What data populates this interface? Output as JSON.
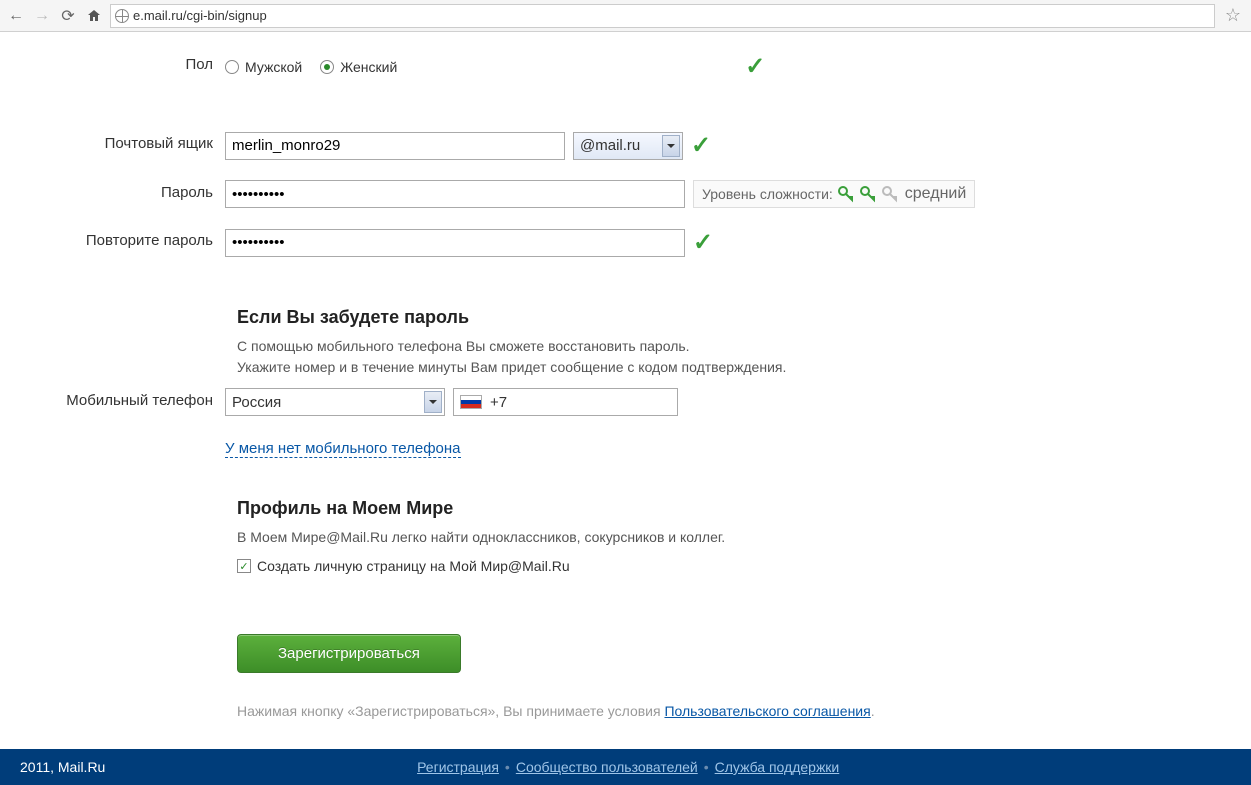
{
  "browser": {
    "url": "e.mail.ru/cgi-bin/signup"
  },
  "form": {
    "gender": {
      "label": "Пол",
      "male": "Мужской",
      "female": "Женский",
      "selected": "female"
    },
    "mailbox": {
      "label": "Почтовый ящик",
      "value": "merlin_monro29",
      "domain": "@mail.ru"
    },
    "password": {
      "label": "Пароль",
      "value": "••••••••••",
      "strength_label": "Уровень сложности:",
      "strength_text": "средний"
    },
    "password_repeat": {
      "label": "Повторите пароль",
      "value": "••••••••••"
    },
    "recovery": {
      "heading": "Если Вы забудете пароль",
      "desc1": "С помощью мобильного телефона Вы сможете восстановить пароль.",
      "desc2": "Укажите номер и в течение минуты Вам придет сообщение с кодом подтверждения."
    },
    "phone": {
      "label": "Мобильный телефон",
      "country": "Россия",
      "prefix": "+7",
      "no_phone_link": "У меня нет мобильного телефона"
    },
    "profile": {
      "heading": "Профиль на Моем Мире",
      "desc": "В Моем Мире@Mail.Ru легко найти одноклассников, сокурсников и коллег.",
      "checkbox_label": "Создать личную страницу на Мой Мир@Mail.Ru"
    },
    "submit": {
      "button": "Зарегистрироваться",
      "terms_prefix": "Нажимая кнопку «Зарегистрироваться», Вы принимаете условия ",
      "terms_link": "Пользовательского соглашения"
    }
  },
  "footer": {
    "copyright": "2011, Mail.Ru",
    "link1": "Регистрация",
    "link2": "Сообщество пользователей",
    "link3": "Служба поддержки"
  }
}
